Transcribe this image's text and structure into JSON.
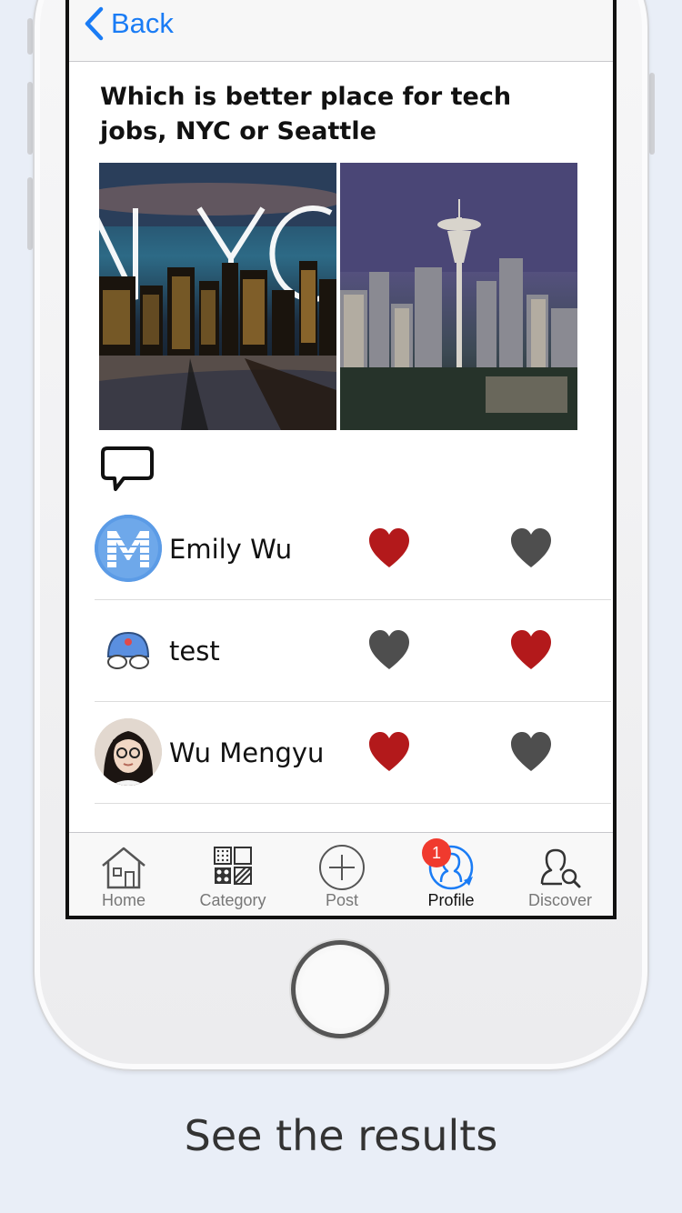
{
  "navbar": {
    "back_label": "Back"
  },
  "post": {
    "question": "Which is better place for tech jobs, NYC or Seattle",
    "photos": [
      {
        "name": "nyc-photo",
        "overlay_text": "NYC"
      },
      {
        "name": "seattle-photo"
      }
    ]
  },
  "votes": [
    {
      "user": "Emily Wu",
      "avatar": "letter-m-avatar",
      "choice": "first"
    },
    {
      "user": "test",
      "avatar": "robot-avatar",
      "choice": "second"
    },
    {
      "user": "Wu Mengyu",
      "avatar": "photo-avatar",
      "choice": "first"
    }
  ],
  "colors": {
    "selected_heart": "#b3191b",
    "unselected_heart": "#4e4e4e",
    "accent": "#1a7cf5",
    "badge": "#f03a2e"
  },
  "tabbar": {
    "items": [
      {
        "label": "Home",
        "icon": "home-icon"
      },
      {
        "label": "Category",
        "icon": "category-icon"
      },
      {
        "label": "Post",
        "icon": "plus-circle-icon"
      },
      {
        "label": "Profile",
        "icon": "profile-icon",
        "badge": "1",
        "active": true
      },
      {
        "label": "Discover",
        "icon": "discover-icon"
      }
    ]
  },
  "caption": "See the results"
}
